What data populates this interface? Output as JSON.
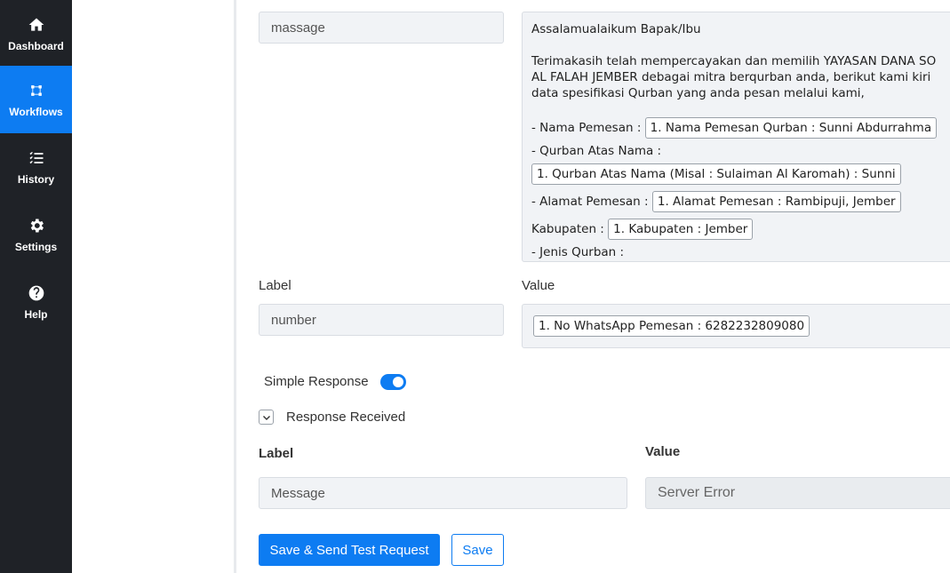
{
  "sidebar": {
    "items": [
      {
        "label": "Dashboard",
        "icon": "home-icon",
        "active": false
      },
      {
        "label": "Workflows",
        "icon": "workflow-icon",
        "active": true
      },
      {
        "label": "History",
        "icon": "list-check-icon",
        "active": false
      },
      {
        "label": "Settings",
        "icon": "gear-icon",
        "active": false
      },
      {
        "label": "Help",
        "icon": "question-circle-icon",
        "active": false
      }
    ]
  },
  "request_params": {
    "row1": {
      "label_value": "massage",
      "message": {
        "greeting": "Assalamualaikum Bapak/Ibu",
        "para1": "Terimakasih telah mempercayakan dan memilih YAYASAN DANA SO",
        "para2": "AL FALAH JEMBER debagai mitra berqurban anda, berikut kami kiri",
        "para3": "data spesifikasi Qurban yang anda pesan melalui kami,",
        "nama_pemesan_label": "- Nama Pemesan :",
        "nama_pemesan_chip": "1. Nama Pemesan Qurban : Sunni Abdurrahma",
        "atas_nama_label": "- Qurban Atas Nama :",
        "atas_nama_chip": "1. Qurban Atas Nama (Misal : Sulaiman Al Karomah) : Sunni",
        "alamat_label": "- Alamat Pemesan :",
        "alamat_chip": "1. Alamat Pemesan : Rambipuji, Jember",
        "kabupaten_label": "Kabupaten :",
        "kabupaten_chip": "1. Kabupaten : Jember",
        "jenis_label": "- Jenis Qurban :"
      }
    },
    "row2": {
      "label_header": "Label",
      "value_header": "Value",
      "label_value": "number",
      "value_chip": "1. No WhatsApp Pemesan : 6282232809080"
    }
  },
  "simple_response": {
    "label": "Simple Response",
    "enabled": true
  },
  "response_received": {
    "label": "Response Received",
    "label_header": "Label",
    "value_header": "Value",
    "label_value": "Message",
    "value": "Server Error"
  },
  "actions": {
    "save_send_label": "Save & Send Test Request",
    "save_label": "Save"
  },
  "colors": {
    "accent": "#0d7cf2",
    "sidebar_bg": "#1f2227"
  }
}
